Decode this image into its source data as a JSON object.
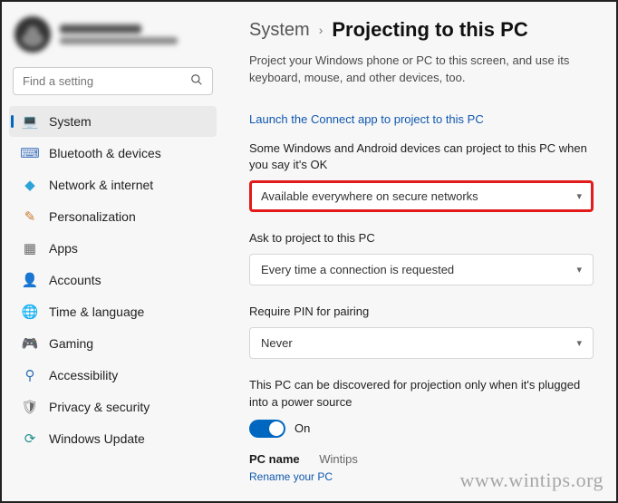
{
  "search": {
    "placeholder": "Find a setting"
  },
  "sidebar": {
    "items": [
      {
        "label": "System",
        "icon": "💻",
        "color": "#3b78c4",
        "name": "sidebar-item-system",
        "active": true
      },
      {
        "label": "Bluetooth & devices",
        "icon": "⌨",
        "color": "#4a7ac0",
        "name": "sidebar-item-bluetooth",
        "active": false
      },
      {
        "label": "Network & internet",
        "icon": "◆",
        "color": "#2ea3d8",
        "name": "sidebar-item-network",
        "active": false
      },
      {
        "label": "Personalization",
        "icon": "✎",
        "color": "#c97a2e",
        "name": "sidebar-item-personalization",
        "active": false
      },
      {
        "label": "Apps",
        "icon": "▦",
        "color": "#6b6b6b",
        "name": "sidebar-item-apps",
        "active": false
      },
      {
        "label": "Accounts",
        "icon": "👤",
        "color": "#4f8a4f",
        "name": "sidebar-item-accounts",
        "active": false
      },
      {
        "label": "Time & language",
        "icon": "🌐",
        "color": "#3a8fae",
        "name": "sidebar-item-time",
        "active": false
      },
      {
        "label": "Gaming",
        "icon": "🎮",
        "color": "#7a7a50",
        "name": "sidebar-item-gaming",
        "active": false
      },
      {
        "label": "Accessibility",
        "icon": "⚲",
        "color": "#2a6fb0",
        "name": "sidebar-item-accessibility",
        "active": false
      },
      {
        "label": "Privacy & security",
        "icon": "🛡",
        "color": "#6b6b6b",
        "name": "sidebar-item-privacy",
        "active": false
      },
      {
        "label": "Windows Update",
        "icon": "⟳",
        "color": "#1f8f8f",
        "name": "sidebar-item-update",
        "active": false
      }
    ]
  },
  "breadcrumb": {
    "parent": "System",
    "title": "Projecting to this PC"
  },
  "description": "Project your Windows phone or PC to this screen, and use its keyboard, mouse, and other devices, too.",
  "launch_link": "Launch the Connect app to project to this PC",
  "sections": {
    "availability": {
      "label": "Some Windows and Android devices can project to this PC when you say it's OK",
      "value": "Available everywhere on secure networks"
    },
    "ask": {
      "label": "Ask to project to this PC",
      "value": "Every time a connection is requested"
    },
    "pin": {
      "label": "Require PIN for pairing",
      "value": "Never"
    }
  },
  "discover": {
    "text": "This PC can be discovered for projection only when it's plugged into a power source",
    "toggle_label": "On"
  },
  "pcname": {
    "label": "PC name",
    "value": "Wintips",
    "rename": "Rename your PC"
  },
  "watermark": "www.wintips.org"
}
